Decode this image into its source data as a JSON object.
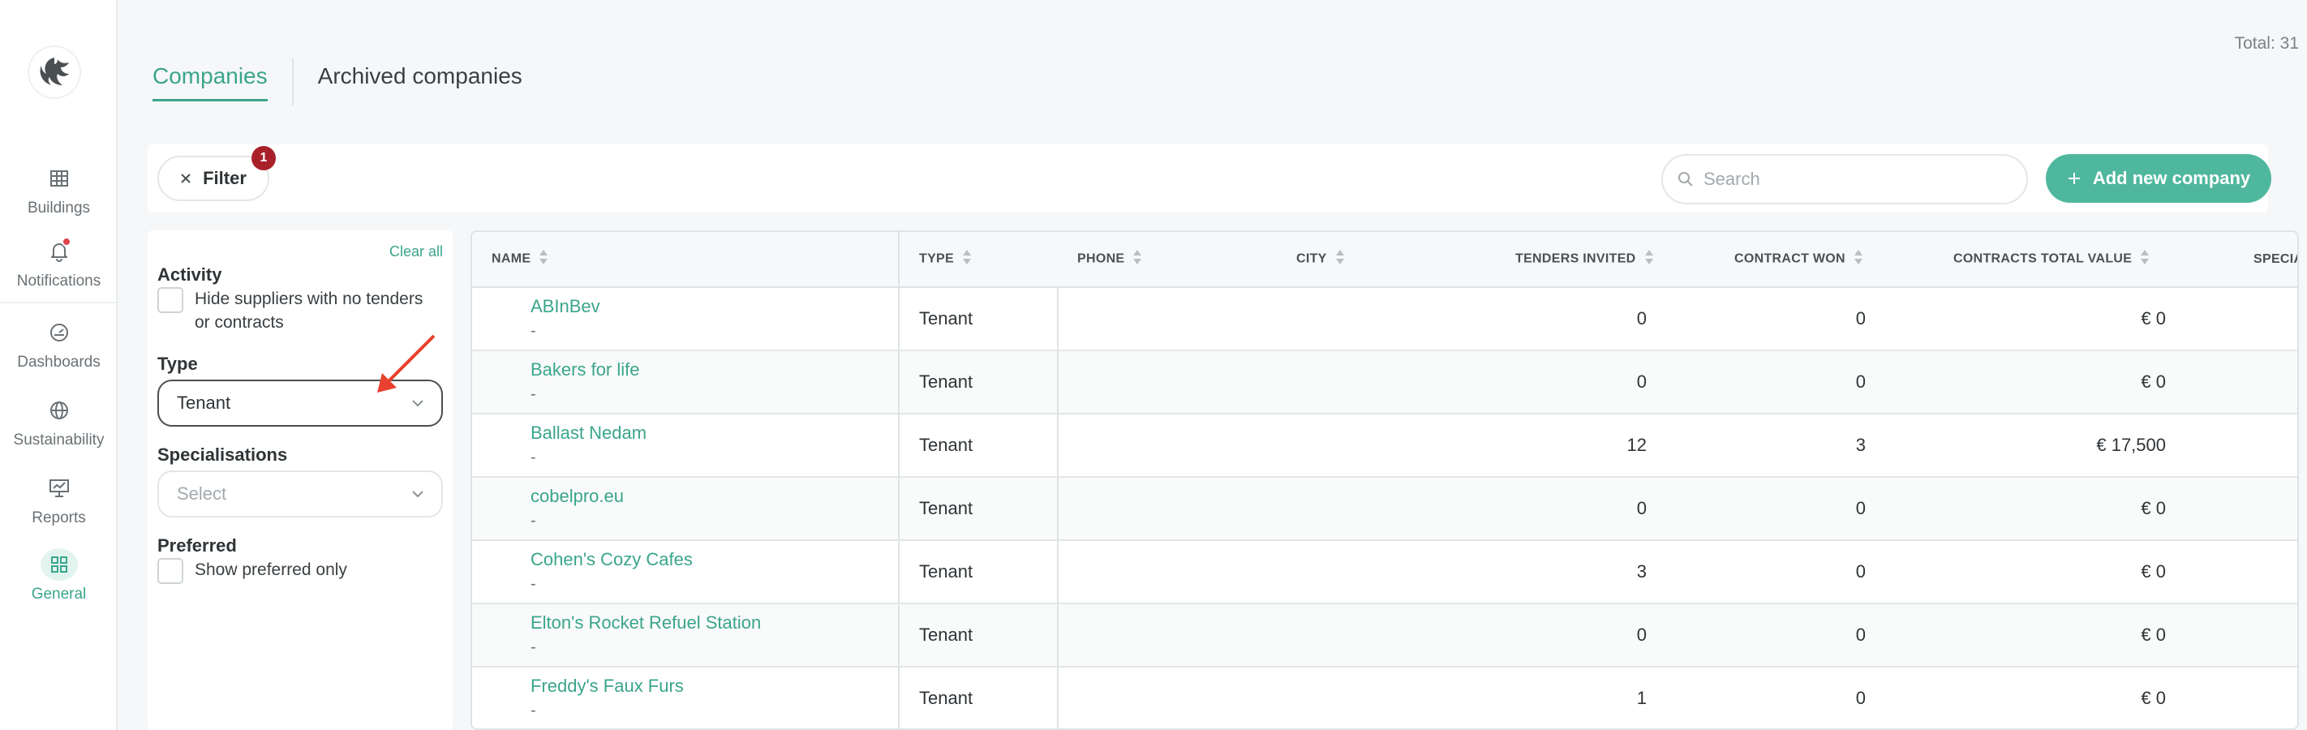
{
  "sidebar": {
    "items": [
      {
        "label": "Buildings",
        "icon": "buildings-icon"
      },
      {
        "label": "Notifications",
        "icon": "bell-icon"
      },
      {
        "label": "Dashboards",
        "icon": "gauge-icon"
      },
      {
        "label": "Sustainability",
        "icon": "globe-icon"
      },
      {
        "label": "Reports",
        "icon": "presentation-icon"
      },
      {
        "label": "General",
        "icon": "grid-icon"
      }
    ]
  },
  "header": {
    "total": "Total: 31",
    "tabs": [
      {
        "label": "Companies"
      },
      {
        "label": "Archived companies"
      }
    ]
  },
  "toolbar": {
    "filter_label": "Filter",
    "filter_count": "1",
    "search_placeholder": "Search",
    "add_label": "Add new company"
  },
  "filters": {
    "clear_all": "Clear all",
    "activity": {
      "title": "Activity",
      "checkbox_label": "Hide suppliers with no tenders or contracts"
    },
    "type": {
      "title": "Type",
      "value": "Tenant"
    },
    "specialisations": {
      "title": "Specialisations",
      "placeholder": "Select"
    },
    "preferred": {
      "title": "Preferred",
      "checkbox_label": "Show preferred only"
    }
  },
  "table": {
    "columns": [
      "NAME",
      "TYPE",
      "PHONE",
      "CITY",
      "TENDERS INVITED",
      "CONTRACT WON",
      "CONTRACTS TOTAL VALUE",
      "SPECIA"
    ],
    "rows": [
      {
        "name": "ABInBev",
        "sub": "-",
        "type": "Tenant",
        "phone": "",
        "city": "",
        "tenders": "0",
        "won": "0",
        "value": "€ 0"
      },
      {
        "name": "Bakers for life",
        "sub": "-",
        "type": "Tenant",
        "phone": "",
        "city": "",
        "tenders": "0",
        "won": "0",
        "value": "€ 0"
      },
      {
        "name": "Ballast Nedam",
        "sub": "-",
        "type": "Tenant",
        "phone": "",
        "city": "",
        "tenders": "12",
        "won": "3",
        "value": "€ 17,500"
      },
      {
        "name": "cobelpro.eu",
        "sub": "-",
        "type": "Tenant",
        "phone": "",
        "city": "",
        "tenders": "0",
        "won": "0",
        "value": "€ 0"
      },
      {
        "name": "Cohen's Cozy Cafes",
        "sub": "-",
        "type": "Tenant",
        "phone": "",
        "city": "",
        "tenders": "3",
        "won": "0",
        "value": "€ 0"
      },
      {
        "name": "Elton's Rocket Refuel Station",
        "sub": "-",
        "type": "Tenant",
        "phone": "",
        "city": "",
        "tenders": "0",
        "won": "0",
        "value": "€ 0"
      },
      {
        "name": "Freddy's Faux Furs",
        "sub": "-",
        "type": "Tenant",
        "phone": "",
        "city": "",
        "tenders": "1",
        "won": "0",
        "value": "€ 0"
      }
    ]
  },
  "colors": {
    "accent": "#4fb79d",
    "annotation_arrow": "#e8412f",
    "badge": "#a8212a"
  }
}
